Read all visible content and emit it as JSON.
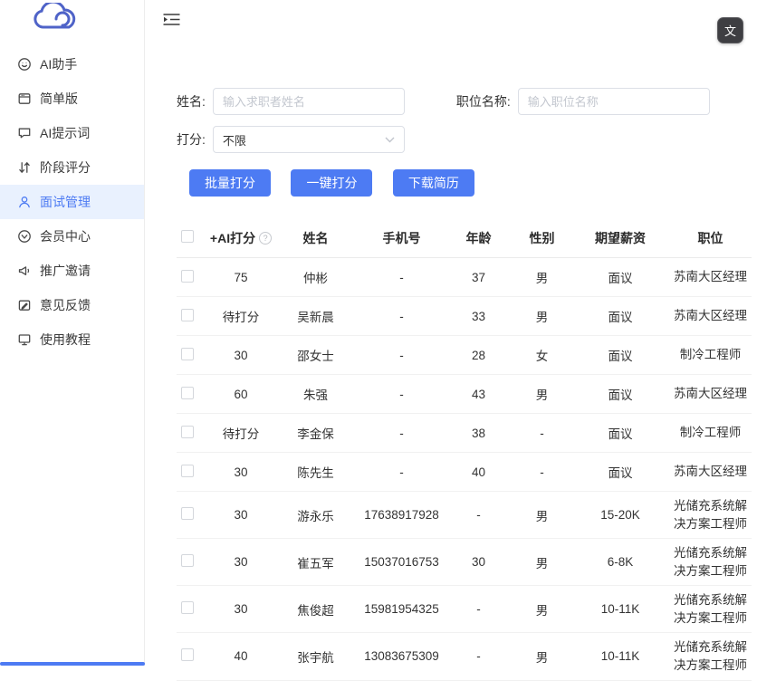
{
  "topbar": {
    "translate_glyph": "文"
  },
  "sidebar": {
    "items": [
      {
        "id": "ai-assistant",
        "icon": "smile-icon",
        "label": "AI助手",
        "active": false
      },
      {
        "id": "simple-version",
        "icon": "window-icon",
        "label": "简单版",
        "active": false
      },
      {
        "id": "ai-prompts",
        "icon": "chat-bubble-icon",
        "label": "AI提示词",
        "active": false
      },
      {
        "id": "stage-score",
        "icon": "sort-arrows-icon",
        "label": "阶段评分",
        "active": false
      },
      {
        "id": "interview-management",
        "icon": "person-icon",
        "label": "面试管理",
        "active": true
      },
      {
        "id": "member-center",
        "icon": "member-badge-icon",
        "label": "会员中心",
        "active": false
      },
      {
        "id": "promotion-invite",
        "icon": "megaphone-icon",
        "label": "推广邀请",
        "active": false
      },
      {
        "id": "feedback",
        "icon": "edit-icon",
        "label": "意见反馈",
        "active": false
      },
      {
        "id": "tutorial",
        "icon": "monitor-icon",
        "label": "使用教程",
        "active": false
      }
    ]
  },
  "filters": {
    "name_label": "姓名:",
    "name_placeholder": "输入求职者姓名",
    "job_label": "职位名称:",
    "job_placeholder": "输入职位名称",
    "score_label": "打分:",
    "score_value": "不限"
  },
  "actions": {
    "batch_score": "批量打分",
    "one_click_score": "一键打分",
    "download_resume": "下载简历"
  },
  "table": {
    "headers": [
      "+AI打分",
      "姓名",
      "手机号",
      "年龄",
      "性别",
      "期望薪资",
      "职位"
    ],
    "help_glyph": "?",
    "rows": [
      {
        "score": "75",
        "name": "仲彬",
        "phone": "-",
        "age": "37",
        "gender": "男",
        "salary": "面议",
        "position": "苏南大区经理"
      },
      {
        "score": "待打分",
        "name": "吴新晨",
        "phone": "-",
        "age": "33",
        "gender": "男",
        "salary": "面议",
        "position": "苏南大区经理"
      },
      {
        "score": "30",
        "name": "邵女士",
        "phone": "-",
        "age": "28",
        "gender": "女",
        "salary": "面议",
        "position": "制冷工程师"
      },
      {
        "score": "60",
        "name": "朱强",
        "phone": "-",
        "age": "43",
        "gender": "男",
        "salary": "面议",
        "position": "苏南大区经理"
      },
      {
        "score": "待打分",
        "name": "李金保",
        "phone": "-",
        "age": "38",
        "gender": "-",
        "salary": "面议",
        "position": "制冷工程师"
      },
      {
        "score": "30",
        "name": "陈先生",
        "phone": "-",
        "age": "40",
        "gender": "-",
        "salary": "面议",
        "position": "苏南大区经理"
      },
      {
        "score": "30",
        "name": "游永乐",
        "phone": "17638917928",
        "age": "-",
        "gender": "男",
        "salary": "15-20K",
        "position": "光储充系统解决方案工程师"
      },
      {
        "score": "30",
        "name": "崔五军",
        "phone": "15037016753",
        "age": "30",
        "gender": "男",
        "salary": "6-8K",
        "position": "光储充系统解决方案工程师"
      },
      {
        "score": "30",
        "name": "焦俊超",
        "phone": "15981954325",
        "age": "-",
        "gender": "男",
        "salary": "10-11K",
        "position": "光储充系统解决方案工程师"
      },
      {
        "score": "40",
        "name": "张宇航",
        "phone": "13083675309",
        "age": "-",
        "gender": "男",
        "salary": "10-11K",
        "position": "光储充系统解决方案工程师"
      }
    ]
  }
}
